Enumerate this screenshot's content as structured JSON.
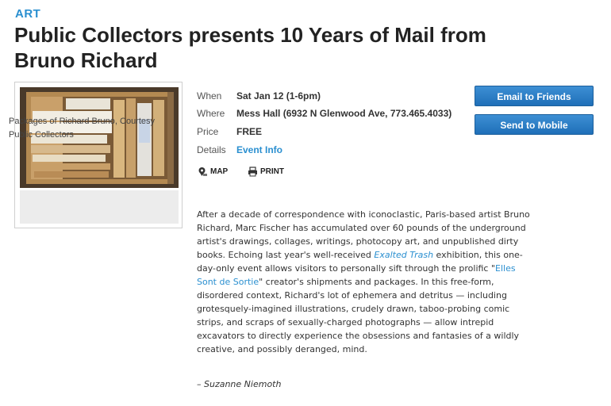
{
  "category": "ART",
  "title": "Public Collectors presents 10 Years of Mail from Bruno Richard",
  "image": {
    "caption": "Packages of Richard Bruno, Courtesy Public Collectors"
  },
  "details": [
    {
      "label": "When",
      "value": "Sat Jan 12 (1-6pm)"
    },
    {
      "label": "Where",
      "value": "Mess Hall (6932 N Glenwood Ave, 773.465.4033)"
    },
    {
      "label": "Price",
      "value": "FREE"
    },
    {
      "label": "Details",
      "value": "Event Info"
    }
  ],
  "actions": {
    "map": "MAP",
    "print": "PRINT"
  },
  "buttons": {
    "email": "Email to Friends",
    "mobile": "Send to Mobile"
  },
  "body": {
    "p1": "After a decade of correspondence with iconoclastic, Paris-based artist Bruno Richard, Marc Fischer has accumulated over 60 pounds of the underground artist's drawings, collages, writings, photocopy art, and unpublished dirty books. Echoing last year's well-received ",
    "link1": "Exalted Trash",
    "p2": " exhibition, this one-day-only event allows visitors to personally sift through the prolific \"",
    "link2": "Elles Sont de Sortie",
    "p3": "\" creator's shipments and packages. In this free-form, disordered context, Richard's lot of ephemera and detritus — including grotesquely-imagined illustrations, crudely drawn, taboo-probing comic strips, and scraps of sexually-charged photographs — allow intrepid excavators to directly experience the obsessions and fantasies of a wildly creative, and possibly deranged, mind."
  },
  "byline": "– Suzanne Niemoth"
}
